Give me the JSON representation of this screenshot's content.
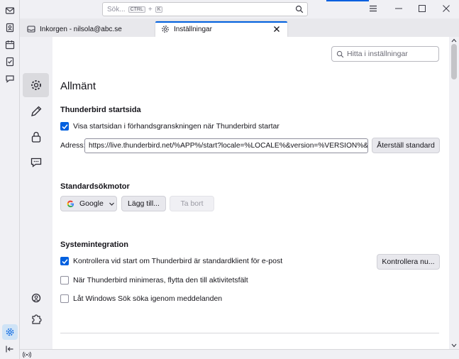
{
  "titlebar": {
    "search_placeholder": "Sök...",
    "kbd_ctrl": "CTRL",
    "kbd_plus": "+",
    "kbd_k": "K"
  },
  "tabs": [
    {
      "label": "Inkorgen - nilsola@abc.se",
      "icon": "inbox-icon"
    },
    {
      "label": "Inställningar",
      "icon": "gear-icon"
    }
  ],
  "settings": {
    "find_placeholder": "Hitta i inställningar",
    "page_title": "Allmänt",
    "startpage": {
      "heading": "Thunderbird startsida",
      "show_checkbox_label": "Visa startsidan i förhandsgranskningen när Thunderbird startar",
      "show_checked": true,
      "address_label": "Adress:",
      "address_value": "https://live.thunderbird.net/%APP%/start?locale=%LOCALE%&version=%VERSION%&ch",
      "reset_button": "Återställ standard"
    },
    "search_engine": {
      "heading": "Standardsökmotor",
      "selected": "Google",
      "add_button": "Lägg till...",
      "remove_button": "Ta bort"
    },
    "system": {
      "heading": "Systemintegration",
      "check_default_label": "Kontrollera vid start om Thunderbird är standardklient för e-post",
      "check_default_checked": true,
      "check_now_button": "Kontrollera nu...",
      "minimize_label": "När Thunderbird minimeras, flytta den till aktivitetsfält",
      "minimize_checked": false,
      "windows_search_label": "Låt Windows Sök söka igenom meddelanden",
      "windows_search_checked": false
    }
  },
  "colors": {
    "accent": "#0060df",
    "background": "#f0f0f4"
  }
}
